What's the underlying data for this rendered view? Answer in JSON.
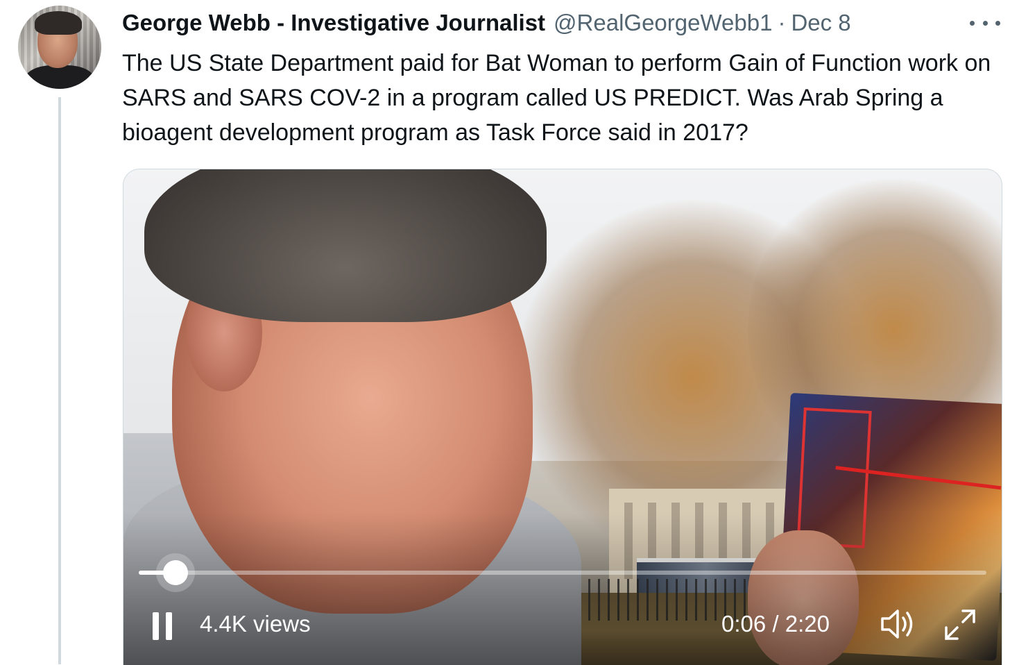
{
  "tweet": {
    "author_name": "George Webb - Investigative Journalist",
    "handle": "@RealGeorgeWebb1",
    "separator": "·",
    "date": "Dec 8",
    "text": "The US State Department paid for Bat Woman to perform Gain of Function work on SARS and SARS COV-2 in a program called US PREDICT. Was Arab Spring a bioagent development program as Task Force said in 2017?"
  },
  "video": {
    "views": "4.4K views",
    "time": "0:06 / 2:20",
    "progress_fraction": 0.043,
    "icons": {
      "play_state": "pause-icon",
      "volume": "volume-icon",
      "fullscreen": "fullscreen-icon",
      "more": "more-icon"
    }
  },
  "colors": {
    "text": "#0f1419",
    "secondary_text": "#536471",
    "thread_line": "#cfd9de"
  }
}
